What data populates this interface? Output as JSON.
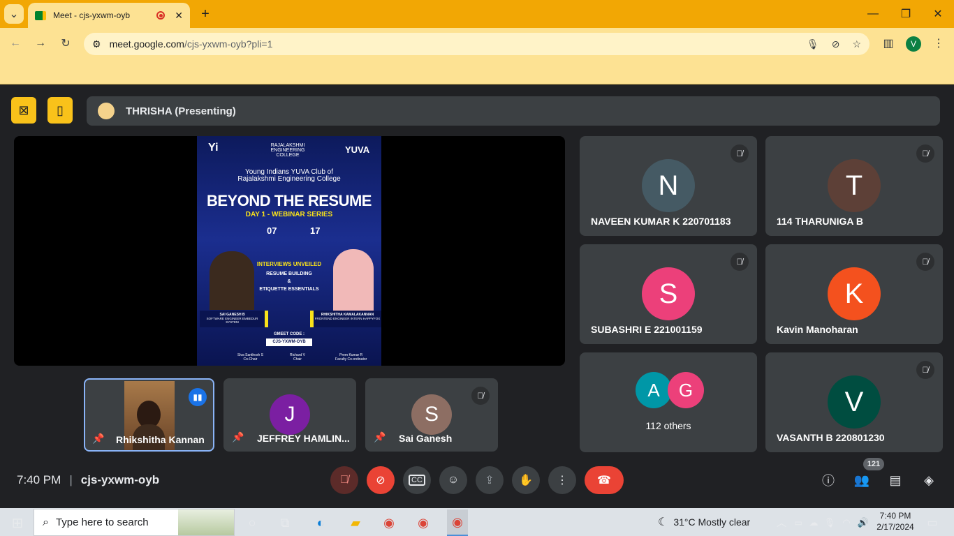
{
  "browser": {
    "tab_title": "Meet - cjs-yxwm-oyb",
    "url_host": "meet.google.com",
    "url_path": "/cjs-yxwm-oyb?pli=1",
    "profile_initial": "V"
  },
  "meet": {
    "presenter_label": "THRISHA (Presenting)",
    "time": "7:40 PM",
    "meeting_code": "cjs-yxwm-oyb",
    "participant_count": "121"
  },
  "poster": {
    "org1": "Yi",
    "org2": "RAJALAKSHMI ENGINEERING COLLEGE",
    "org3": "YUVA",
    "club_line1": "Young Indians YUVA Club of",
    "club_line2": "Rajalakshmi Engineering College",
    "title": "BEYOND THE RESUME",
    "subtitle": "DAY 1 - WEBINAR SERIES",
    "time": "07",
    "date": "17",
    "topic1": "INTERVIEWS UNVEILED",
    "topic2": "RESUME BUILDING",
    "topic3": "&",
    "topic4": "ETIQUETTE ESSENTIALS",
    "speaker1_name": "SAI GANESH B",
    "speaker1_role": "SOFTWARE ENGINEER EMBEDUR SYSTEM",
    "speaker2_name": "RHIKSHITHA KAMALAKANNAN",
    "speaker2_role": "FRONTEND ENGINEER INTERN HAPPYFOX",
    "gmeet_label": "GMEET CODE :",
    "gmeet_code": "CJS-YXWM-OYB",
    "footer1": "Siva Santhosh S",
    "footer1_role": "Co-Chair",
    "footer2": "Richard V",
    "footer2_role": "Chair",
    "footer3": "Prem Kumar R",
    "footer3_role": "Faculty Co-ordinator"
  },
  "right_tiles": [
    {
      "initial": "N",
      "name": "NAVEEN KUMAR K 220701183",
      "color": "#455a64"
    },
    {
      "initial": "T",
      "name": "114 THARUNIGA B",
      "color": "#5d4037"
    },
    {
      "initial": "S",
      "name": "SUBASHRI E 221001159",
      "color": "#ec407a"
    },
    {
      "initial": "K",
      "name": "Kavin Manoharan",
      "color": "#f4511e"
    },
    {
      "initial_a": "A",
      "initial_b": "G",
      "name": "112 others",
      "color_a": "#0097a7",
      "color_b": "#ec407a"
    },
    {
      "initial": "V",
      "name": "VASANTH B 220801230",
      "color": "#004d40"
    }
  ],
  "filmstrip": [
    {
      "name": "Rhikshitha Kannan"
    },
    {
      "initial": "J",
      "name": "JEFFREY HAMLIN...",
      "color": "#7b1fa2"
    },
    {
      "initial": "S",
      "name": "Sai Ganesh",
      "color": "#8d6e63"
    }
  ],
  "taskbar": {
    "search_placeholder": "Type here to search",
    "weather": "31°C  Mostly clear",
    "clock_time": "7:40 PM",
    "clock_date": "2/17/2024"
  }
}
